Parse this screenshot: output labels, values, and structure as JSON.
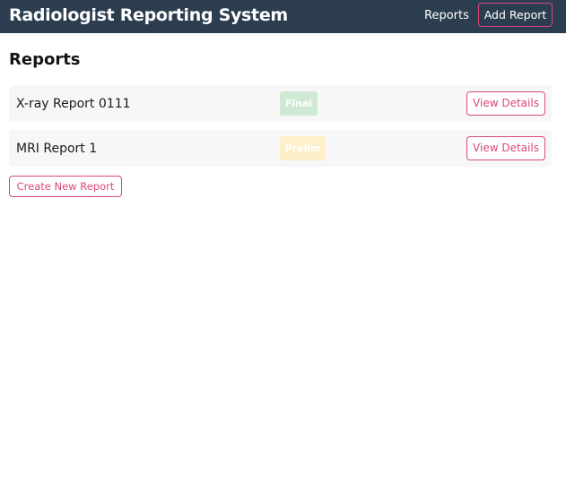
{
  "header": {
    "title": "Radiologist Reporting System",
    "nav_reports": "Reports",
    "nav_add_report": "Add Report"
  },
  "main": {
    "heading": "Reports",
    "reports": [
      {
        "title": "X-ray Report 0111",
        "status": "Final",
        "status_color": "#cfe9d4",
        "action": "View Details"
      },
      {
        "title": "MRI Report 1",
        "status": "Prelim",
        "status_color": "#fdf0c8",
        "action": "View Details"
      }
    ],
    "create_button": "Create New Report"
  },
  "colors": {
    "header_bg": "#2b3d4f",
    "accent": "#d9487a",
    "row_bg": "#f7f7f7"
  }
}
